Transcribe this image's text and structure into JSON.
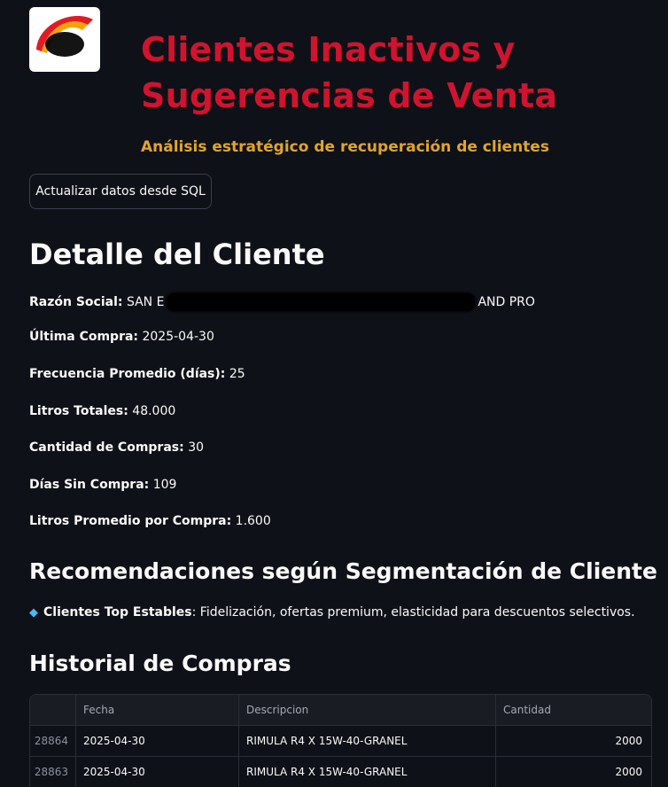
{
  "header": {
    "title_line1": "Clientes Inactivos y",
    "title_line2": "Sugerencias de Venta",
    "subtitle": "Análisis estratégico de recuperación de clientes",
    "refresh_button": "Actualizar datos desde SQL"
  },
  "detail": {
    "heading": "Detalle del Cliente",
    "razon_social": {
      "label": "Razón Social:",
      "value_start": "SAN E",
      "value_end": "AND PRO"
    },
    "ultima_compra": {
      "label": "Última Compra:",
      "value": "2025-04-30"
    },
    "frecuencia": {
      "label": "Frecuencia Promedio (días):",
      "value": "25"
    },
    "litros_totales": {
      "label": "Litros Totales:",
      "value": "48.000"
    },
    "cantidad_compras": {
      "label": "Cantidad de Compras:",
      "value": "30"
    },
    "dias_sin_compra": {
      "label": "Días Sin Compra:",
      "value": "109"
    },
    "litros_promedio": {
      "label": "Litros Promedio por Compra:",
      "value": "1.600"
    }
  },
  "recommendations": {
    "heading": "Recomendaciones según Segmentación de Cliente",
    "segment_label": "Clientes Top Estables",
    "segment_text": ": Fidelización, ofertas premium, elasticidad para descuentos selectivos.",
    "icon": "gem-icon"
  },
  "history": {
    "heading": "Historial de Compras",
    "columns": [
      "",
      "Fecha",
      "Descripcion",
      "Cantidad"
    ],
    "rows": [
      {
        "index": "28864",
        "fecha": "2025-04-30",
        "descripcion": "RIMULA R4 X 15W-40-GRANEL",
        "cantidad": "2000"
      },
      {
        "index": "28863",
        "fecha": "2025-04-30",
        "descripcion": "RIMULA R4 X 15W-40-GRANEL",
        "cantidad": "2000"
      }
    ]
  },
  "colors": {
    "background": "#0e1117",
    "title": "#d0132f",
    "subtitle": "#e0a52c",
    "text": "#fafafa"
  }
}
